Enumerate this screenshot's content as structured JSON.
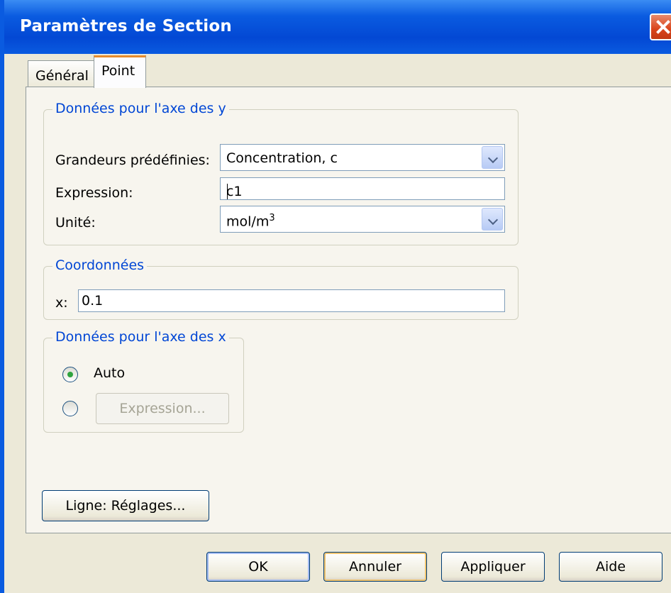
{
  "window": {
    "title": "Paramètres de Section"
  },
  "tabs": [
    {
      "label": "Général"
    },
    {
      "label": "Point"
    }
  ],
  "y_axis_group": {
    "legend": "Données pour l'axe des y",
    "predefined_label": "Grandeurs prédéfinies:",
    "predefined_value": "Concentration, c",
    "expression_label": "Expression:",
    "expression_value": "c1",
    "unit_label": "Unité:",
    "unit_value_base": "mol/m",
    "unit_value_sup": "3"
  },
  "coords_group": {
    "legend": "Coordonnées",
    "x_label": "x:",
    "x_value": "0.1"
  },
  "x_axis_group": {
    "legend": "Données pour l'axe des x",
    "auto_label": "Auto",
    "auto_selected": true,
    "expression_button": "Expression..."
  },
  "line_settings_button": "Ligne: Réglages...",
  "footer": {
    "ok": "OK",
    "cancel": "Annuler",
    "apply": "Appliquer",
    "help": "Aide"
  }
}
